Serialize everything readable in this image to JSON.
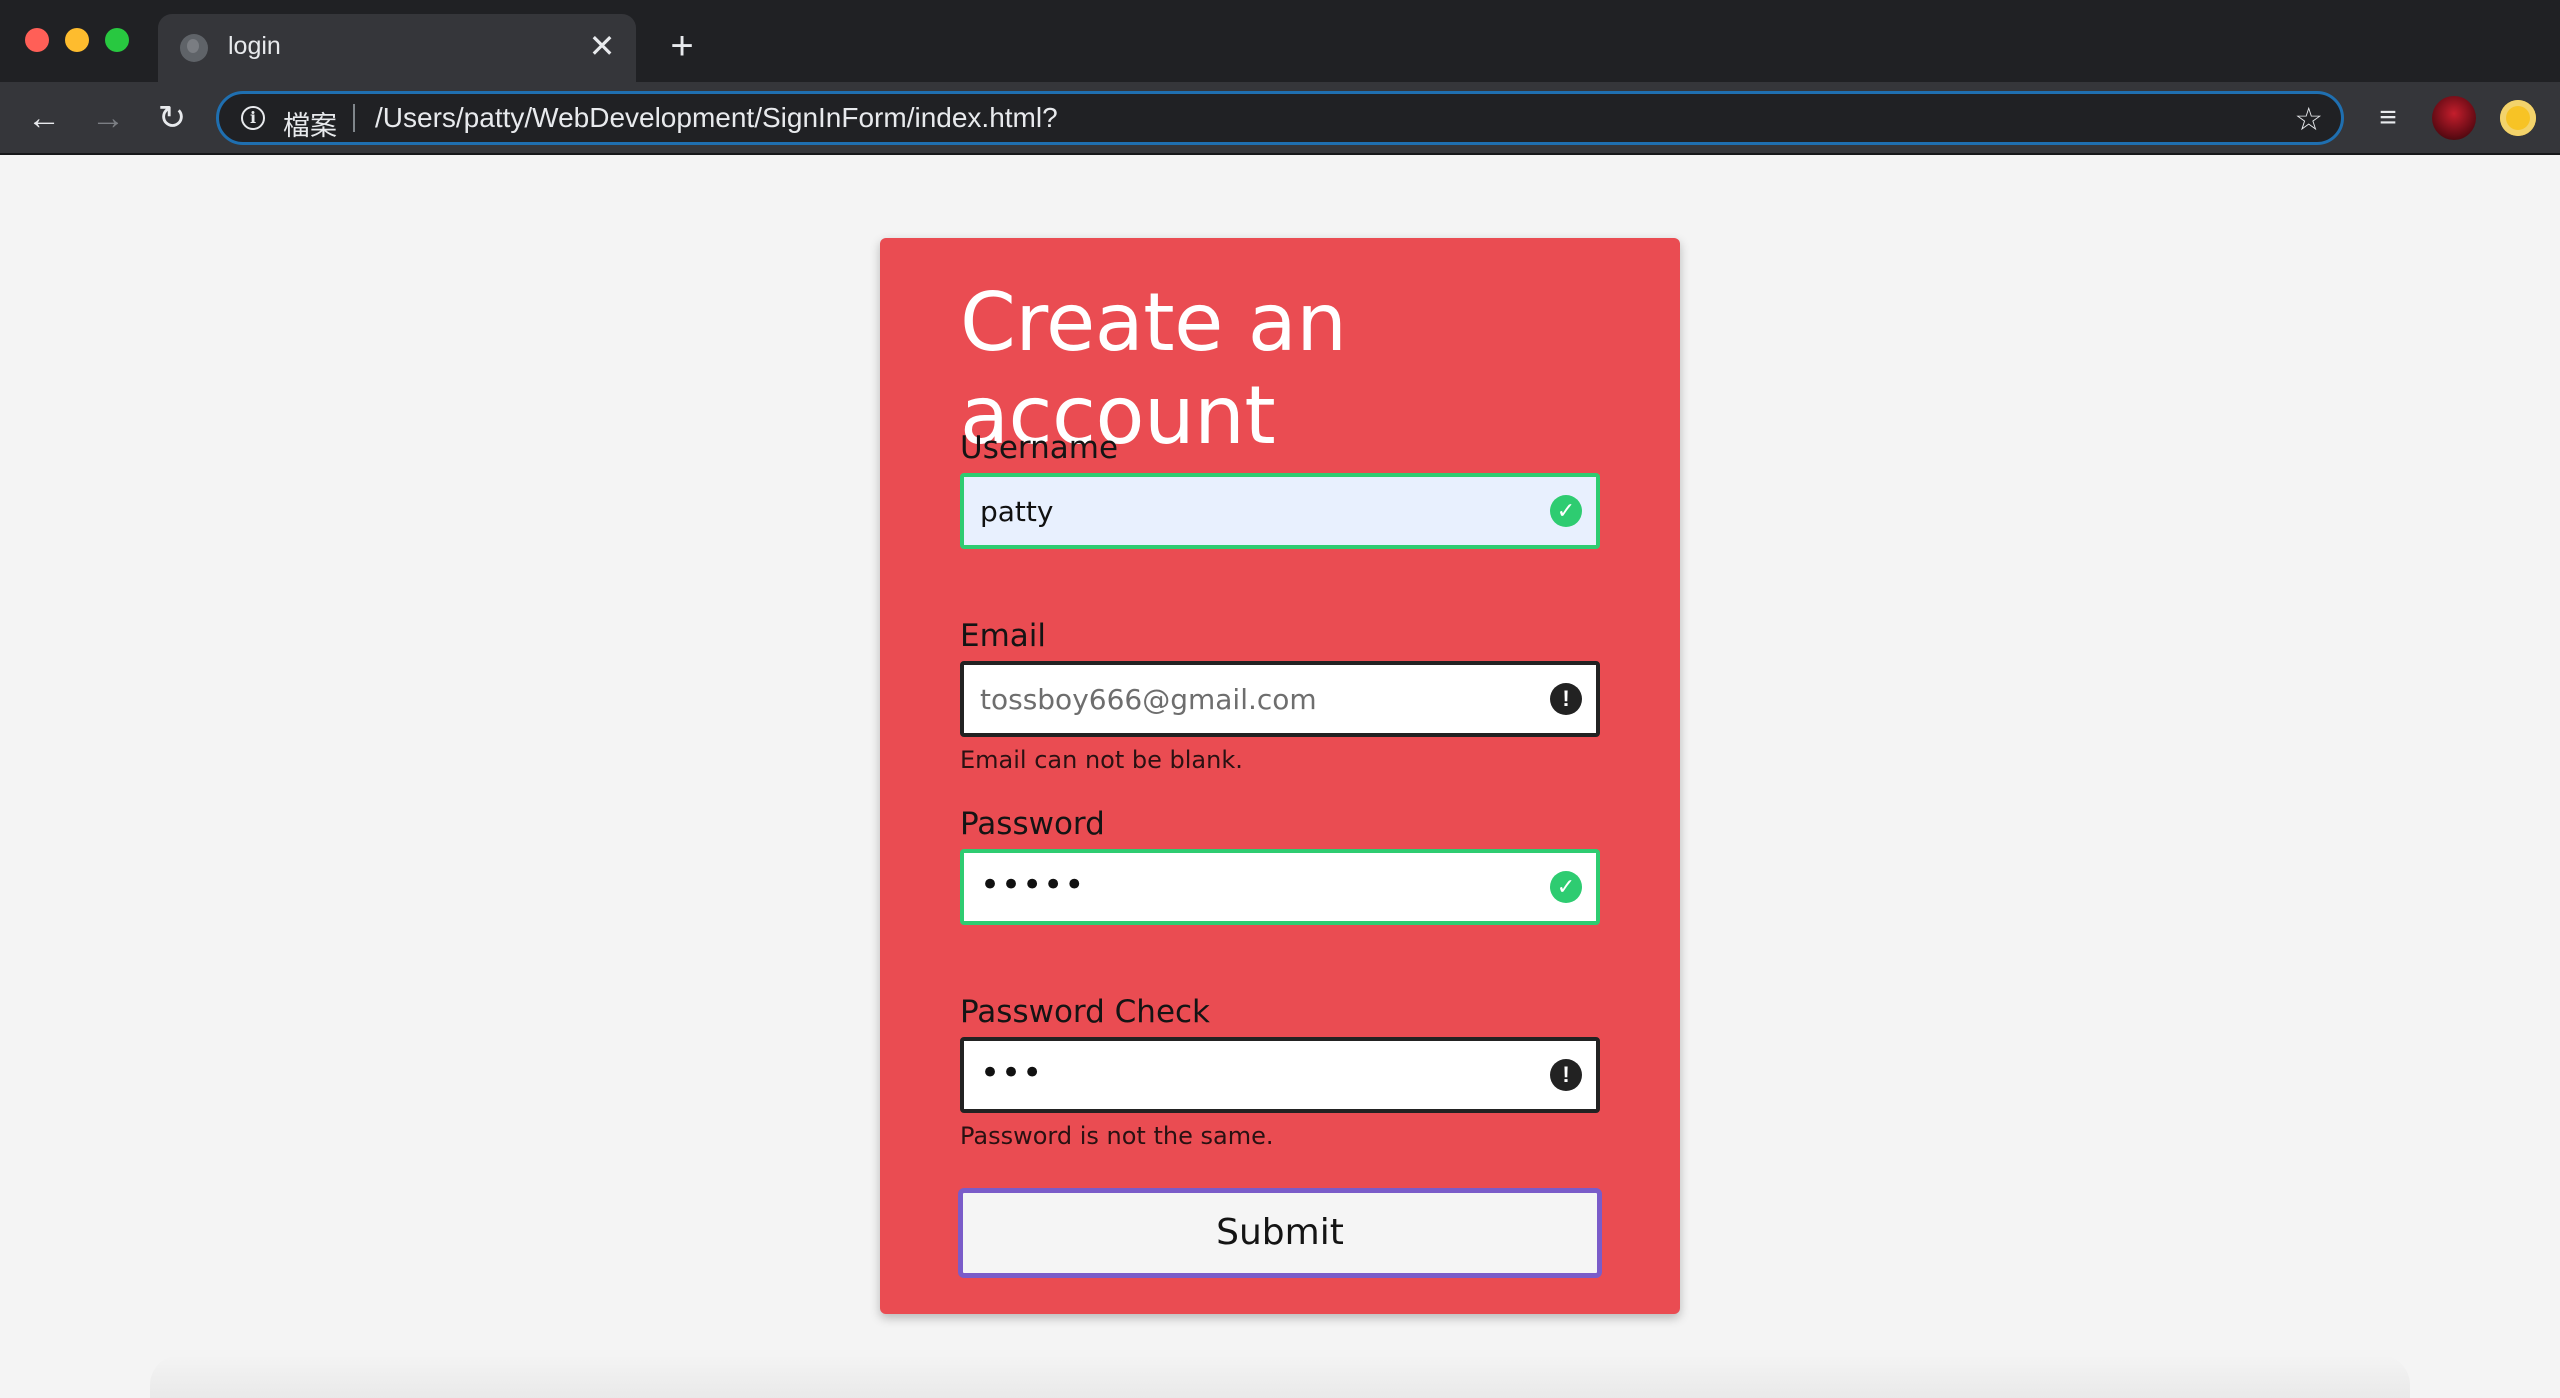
{
  "browser": {
    "tab_title": "login",
    "tab_close": "✕",
    "new_tab": "+",
    "site_chip": "檔案",
    "url": "/Users/patty/WebDevelopment/SignInForm/index.html?",
    "icons": {
      "back": "←",
      "forward": "→",
      "reload": "↻",
      "info": "i",
      "star": "☆",
      "queue": "≡"
    }
  },
  "form": {
    "title": "Create an account",
    "username": {
      "label": "Username",
      "value": "patty",
      "status": "success",
      "status_icon": "✓"
    },
    "email": {
      "label": "Email",
      "placeholder": "tossboy666@gmail.com",
      "status": "error",
      "status_icon": "!",
      "error": "Email can not be blank."
    },
    "password": {
      "label": "Password",
      "value": "•••••",
      "status": "success",
      "status_icon": "✓"
    },
    "password_check": {
      "label": "Password Check",
      "value": "•••",
      "status": "error",
      "status_icon": "!",
      "error": "Password is not the same."
    },
    "submit_label": "Submit"
  },
  "colors": {
    "card": "#ea4c52",
    "success": "#2ecc71",
    "error_border": "#222222",
    "focus": "#7a5cc9"
  }
}
